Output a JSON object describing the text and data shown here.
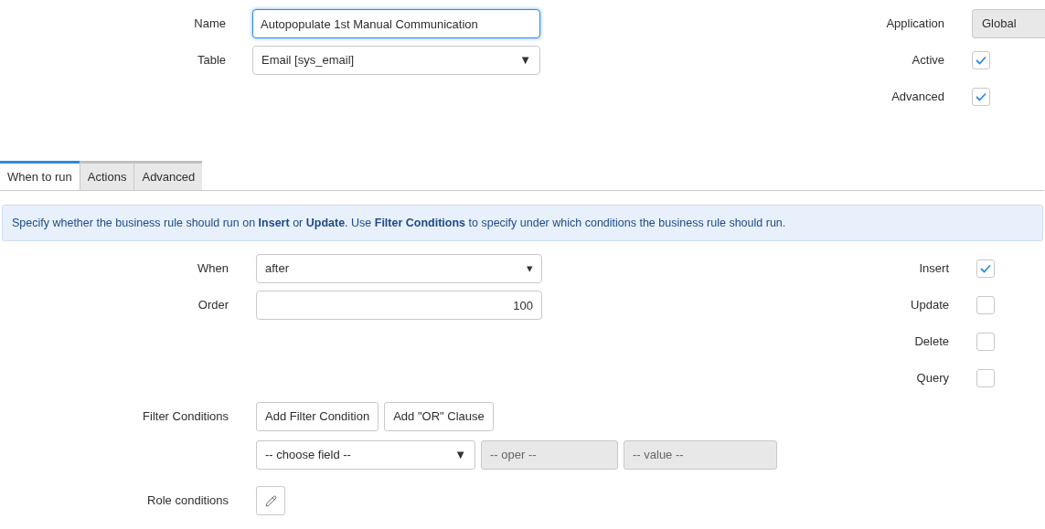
{
  "header": {
    "fields": [
      {
        "kind": "text",
        "label": "Name",
        "value": "Autopopulate 1st Manual Communication",
        "focused": true
      },
      {
        "kind": "select",
        "label": "Table",
        "value": "Email [sys_email]",
        "arrow": "▼"
      }
    ],
    "side": [
      {
        "kind": "readonly",
        "label": "Application",
        "value": "Global"
      },
      {
        "kind": "checkbox",
        "label": "Active",
        "checked": true
      },
      {
        "kind": "checkbox",
        "label": "Advanced",
        "checked": true
      }
    ]
  },
  "tabs": [
    {
      "label": "When to run",
      "selected": true
    },
    {
      "label": "Actions",
      "selected": false
    },
    {
      "label": "Advanced",
      "selected": false
    }
  ],
  "info": "Specify whether the business rule should run on **Insert** or **Update**. Use **Filter Conditions** to specify under which conditions the business rule should run.",
  "when_to_run": {
    "fields": [
      {
        "kind": "select",
        "label": "When",
        "value": "after",
        "arrow": "▾"
      },
      {
        "kind": "number",
        "label": "Order",
        "value": "100"
      }
    ],
    "side": [
      {
        "kind": "checkbox",
        "label": "Insert",
        "checked": true
      },
      {
        "kind": "checkbox",
        "label": "Update",
        "checked": false
      },
      {
        "kind": "checkbox",
        "label": "Delete",
        "checked": false
      },
      {
        "kind": "checkbox",
        "label": "Query",
        "checked": false
      }
    ],
    "filter_conditions": {
      "label": "Filter Conditions",
      "buttons": [
        "Add Filter Condition",
        "Add \"OR\" Clause"
      ],
      "field": "-- choose field --",
      "field_arrow": "▼",
      "operator_placeholder": "-- oper --",
      "value_placeholder": "-- value --"
    },
    "role_conditions": {
      "label": "Role conditions"
    }
  }
}
